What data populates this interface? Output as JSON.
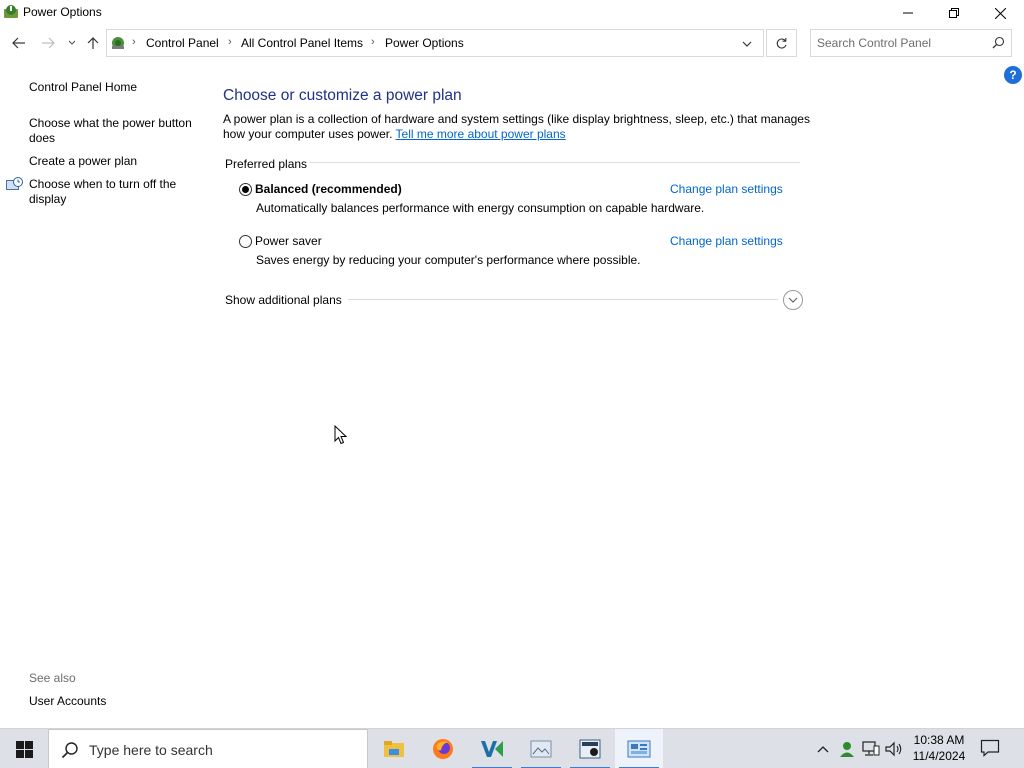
{
  "window": {
    "title": "Power Options"
  },
  "address": {
    "breadcrumbs": [
      "Control Panel",
      "All Control Panel Items",
      "Power Options"
    ]
  },
  "search": {
    "placeholder": "Search Control Panel"
  },
  "sidebar": {
    "home": "Control Panel Home",
    "links": [
      "Choose what the power button does",
      "Create a power plan",
      "Choose when to turn off the display"
    ],
    "see_also_label": "See also",
    "see_also_links": [
      "User Accounts"
    ]
  },
  "main": {
    "title": "Choose or customize a power plan",
    "description": "A power plan is a collection of hardware and system settings (like display brightness, sleep, etc.) that manages how your computer uses power.",
    "description_link": "Tell me more about power plans",
    "preferred_label": "Preferred plans",
    "plans": [
      {
        "name": "Balanced (recommended)",
        "description": "Automatically balances performance with energy consumption on capable hardware.",
        "selected": true,
        "link": "Change plan settings"
      },
      {
        "name": "Power saver",
        "description": "Saves energy by reducing your computer's performance where possible.",
        "selected": false,
        "link": "Change plan settings"
      }
    ],
    "show_additional": "Show additional plans"
  },
  "taskbar": {
    "search_placeholder": "Type here to search",
    "apps": [
      "file-explorer-icon",
      "firefox-icon",
      "visual-studio-icon",
      "image-viewer-icon",
      "app-icon",
      "control-panel-icon"
    ],
    "clock_time": "10:38 AM",
    "clock_date": "11/4/2024"
  },
  "colors": {
    "title_blue": "#1e3287",
    "link_blue": "#0066cc",
    "accent": "#3b7dd8"
  }
}
